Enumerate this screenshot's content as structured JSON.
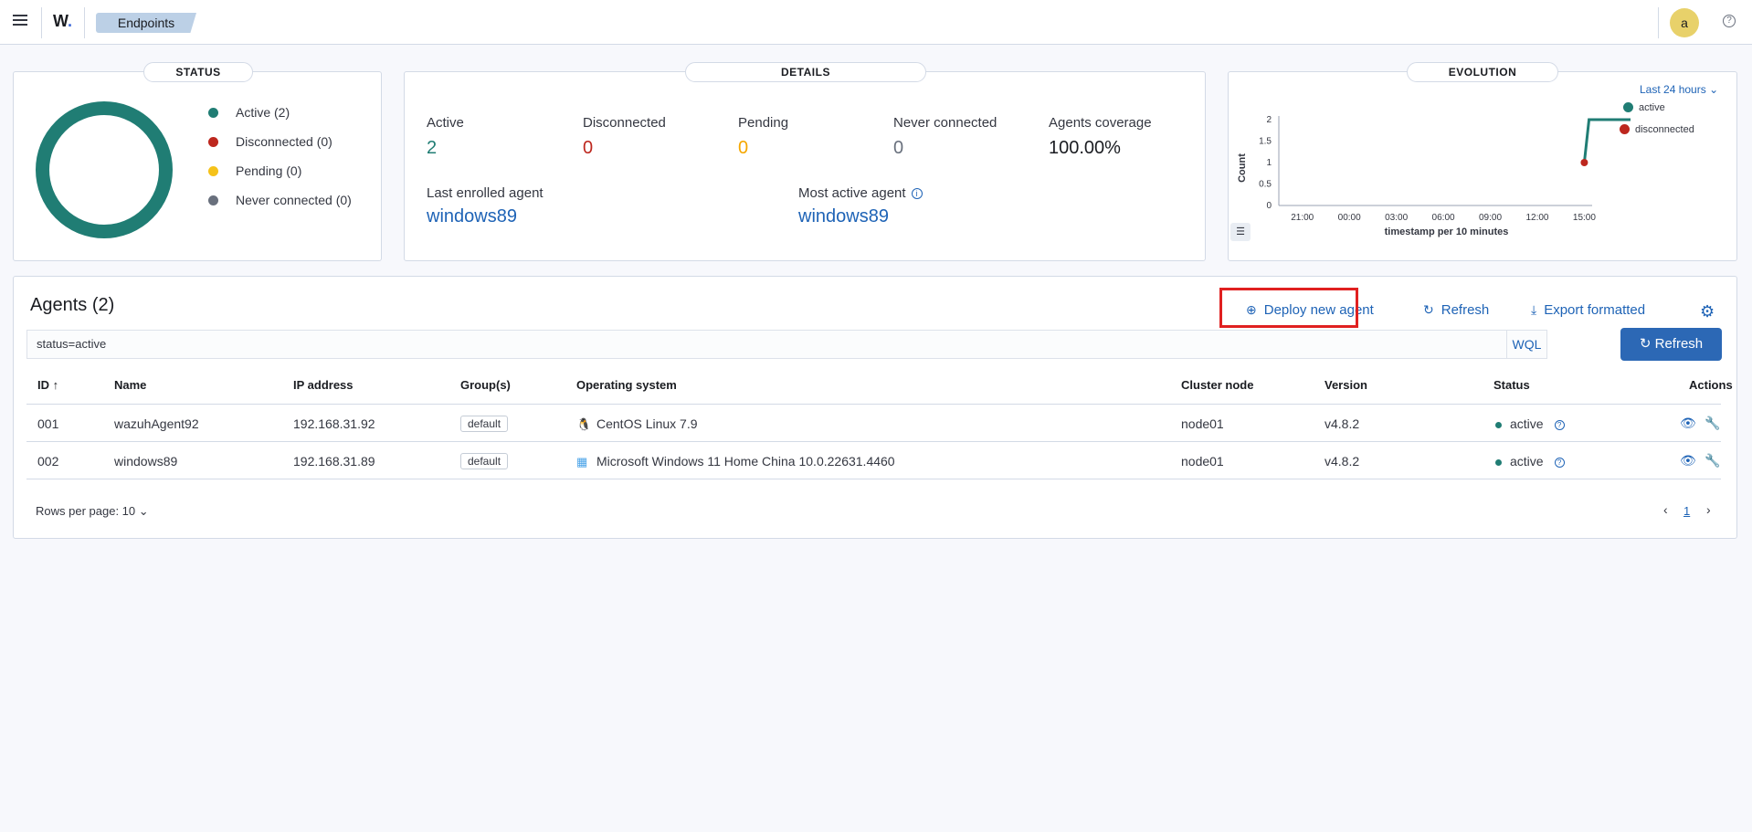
{
  "header": {
    "logo": "W",
    "breadcrumb": "Endpoints",
    "avatar_letter": "a",
    "help": "?"
  },
  "status_panel": {
    "title": "STATUS",
    "legend": [
      {
        "label": "Active (2)",
        "color": "#207d74"
      },
      {
        "label": "Disconnected (0)",
        "color": "#bd271e"
      },
      {
        "label": "Pending (0)",
        "color": "#f5c21a"
      },
      {
        "label": "Never connected (0)",
        "color": "#69707d"
      }
    ]
  },
  "details_panel": {
    "title": "DETAILS",
    "stats": [
      {
        "label": "Active",
        "value": "2",
        "color": "#207d74"
      },
      {
        "label": "Disconnected",
        "value": "0",
        "color": "#bd271e"
      },
      {
        "label": "Pending",
        "value": "0",
        "color": "#f5a700"
      },
      {
        "label": "Never connected",
        "value": "0",
        "color": "#69707d"
      },
      {
        "label": "Agents coverage",
        "value": "100.00%",
        "color": "#1a1c21"
      }
    ],
    "last_enrolled_label": "Last enrolled agent",
    "last_enrolled_value": "windows89",
    "most_active_label": "Most active agent",
    "most_active_value": "windows89"
  },
  "evolution_panel": {
    "title": "EVOLUTION",
    "range_label": "Last 24 hours",
    "legend": [
      {
        "label": "active",
        "color": "#207d74"
      },
      {
        "label": "disconnected",
        "color": "#bd271e"
      }
    ]
  },
  "chart_data": {
    "type": "line",
    "xlabel": "timestamp per 10 minutes",
    "ylabel": "Count",
    "x_ticks": [
      "21:00",
      "00:00",
      "03:00",
      "06:00",
      "09:00",
      "12:00",
      "15:00"
    ],
    "y_ticks": [
      "0",
      "0.5",
      "1",
      "1.5",
      "2"
    ],
    "ylim": [
      0,
      2
    ],
    "series": [
      {
        "name": "active",
        "color": "#207d74",
        "points": [
          {
            "x": 15.0,
            "y": 1
          },
          {
            "x": 15.2,
            "y": 2
          },
          {
            "x": 18.5,
            "y": 2
          }
        ]
      },
      {
        "name": "disconnected",
        "color": "#bd271e",
        "points": [
          {
            "x": 15.0,
            "y": 1
          }
        ]
      }
    ],
    "x_domain_hours": [
      18.5,
      18.5
    ]
  },
  "agents": {
    "title": "Agents (2)",
    "deploy_label": "Deploy new agent",
    "refresh_label": "Refresh",
    "export_label": "Export formatted",
    "search_value": "status=active",
    "wql_label": "WQL",
    "refresh_button_label": "Refresh",
    "columns": [
      "ID",
      "Name",
      "IP address",
      "Group(s)",
      "Operating system",
      "Cluster node",
      "Version",
      "Status",
      "Actions"
    ],
    "rows": [
      {
        "id": "001",
        "name": "wazuhAgent92",
        "ip": "192.168.31.92",
        "group": "default",
        "os": "CentOS Linux 7.9",
        "os_icon": "linux-penguin-icon",
        "node": "node01",
        "version": "v4.8.2",
        "status": "active"
      },
      {
        "id": "002",
        "name": "windows89",
        "ip": "192.168.31.89",
        "group": "default",
        "os": "Microsoft Windows 11 Home China 10.0.22631.4460",
        "os_icon": "windows-icon",
        "node": "node01",
        "version": "v4.8.2",
        "status": "active"
      }
    ],
    "rows_per_page": "Rows per page: 10",
    "current_page": "1"
  }
}
